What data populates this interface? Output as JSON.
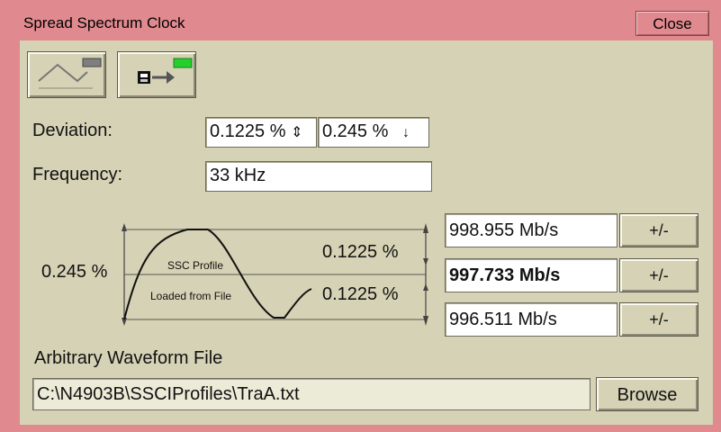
{
  "window": {
    "title": "Spread Spectrum Clock",
    "close_label": "Close"
  },
  "toolbar": {
    "profile_icon": "waveform-icon",
    "load_icon": "load-from-file-icon"
  },
  "deviation": {
    "label": "Deviation:",
    "value1": "0.1225 %",
    "value2": "0.245 %",
    "spin_glyph": "⇕",
    "down_glyph": "↓"
  },
  "frequency": {
    "label": "Frequency:",
    "value": "33 kHz"
  },
  "profile": {
    "total_label": "0.245 %",
    "upper_label": "0.1225 %",
    "lower_label": "0.1225 %",
    "name_label": "SSC Profile",
    "source_label": "Loaded from File"
  },
  "rates": [
    {
      "value": "998.955 Mb/s",
      "button": "+/-",
      "bold": false
    },
    {
      "value": "997.733 Mb/s",
      "button": "+/-",
      "bold": true
    },
    {
      "value": "996.511 Mb/s",
      "button": "+/-",
      "bold": false
    }
  ],
  "file": {
    "label": "Arbitrary Waveform File",
    "path": "C:\\N4903B\\SSCIProfiles\\TraA.txt",
    "browse_label": "Browse"
  },
  "colors": {
    "titlebar": "#e08a8f",
    "panel": "#d6d2b5",
    "led_gray": "#7f7f7f",
    "led_green": "#25d02a"
  }
}
